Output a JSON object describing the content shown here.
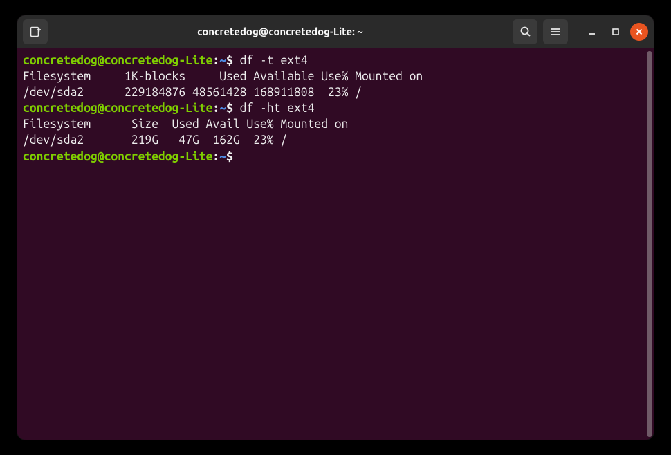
{
  "window": {
    "title": "concretedog@concretedog-Lite: ~"
  },
  "prompt": {
    "user_host": "concretedog@concretedog-Lite",
    "colon": ":",
    "path": "~",
    "symbol": "$"
  },
  "session": [
    {
      "cmd": "df -t ext4",
      "output": [
        "Filesystem     1K-blocks     Used Available Use% Mounted on",
        "/dev/sda2      229184876 48561428 168911808  23% /"
      ]
    },
    {
      "cmd": "df -ht ext4",
      "output": [
        "Filesystem      Size  Used Avail Use% Mounted on",
        "/dev/sda2       219G   47G  162G  23% /"
      ]
    },
    {
      "cmd": "",
      "output": []
    }
  ]
}
